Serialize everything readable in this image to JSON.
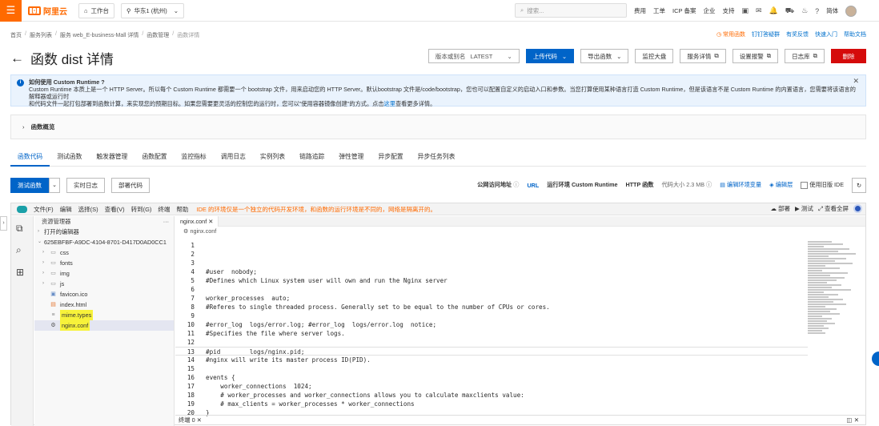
{
  "topbar": {
    "logo_text": "阿里云",
    "workbench": "工作台",
    "region": "华东1 (杭州)",
    "search_placeholder": "搜索...",
    "items": [
      "费用",
      "工单",
      "ICP 备案",
      "企业",
      "支持"
    ],
    "lang": "简体"
  },
  "breadcrumb": [
    "首页",
    "服务列表",
    "服务 web_E-business-Mall 详情",
    "函数管理",
    "函数详情"
  ],
  "top_links": {
    "hot": "常用函数",
    "items": [
      "钉钉答疑群",
      "有奖反馈",
      "快速入门",
      "帮助文档"
    ]
  },
  "title": "函数 dist 详情",
  "actions": {
    "version_label": "版本或别名",
    "version_value": "LATEST",
    "upload": "上传代码",
    "export": "导出函数",
    "monitor": "监控大盘",
    "service_detail": "服务详情",
    "alarm": "设置报警",
    "logs": "日志库",
    "delete": "删除"
  },
  "notice": {
    "title": "如何使用 Custom Runtime ?",
    "line1": "Custom Runtime 本质上是一个 HTTP Server。所以每个 Custom Runtime 都需要一个 bootstrap 文件，用来启动您的 HTTP Server。默认bootstrap 文件是/code/bootstrap，您也可以配置自定义的启动入口和参数。当您打算使用某种语言打造 Custom Runtime，但是该语言不是 Custom Runtime 的内置语言，您需要将该语言的解释器或运行时",
    "line2a": "和代码文件一起打包部署到函数计算，来实现您的预期目标。如果您需要更灵活的控制您的运行时，您可以\"使用容器镜像创建\"的方式。点击",
    "link": "这里",
    "line2b": "查看更多详情。"
  },
  "overview": "函数概览",
  "tabs": [
    "函数代码",
    "测试函数",
    "触发器管理",
    "函数配置",
    "监控指标",
    "调用日志",
    "实例列表",
    "链路追踪",
    "弹性管理",
    "异步配置",
    "异步任务列表"
  ],
  "subbar": {
    "test": "测试函数",
    "realtime_log": "实时日志",
    "deploy": "部署代码",
    "public_url": "公网访问地址",
    "url": "URL",
    "runtime": "运行环境 Custom Runtime",
    "http": "HTTP 函数",
    "size": "代码大小 2.3 MB",
    "edit_env": "编辑环境变量",
    "edit_layer": "编辑层",
    "old_ide": "使用旧版 IDE"
  },
  "ide": {
    "menu": [
      "文件(F)",
      "编辑",
      "选择(S)",
      "查看(V)",
      "转到(G)",
      "终端",
      "帮助"
    ],
    "warning": "IDE 的环境仅是一个独立的代码开发环境，和函数的运行环境是不同的，网络是隔离开的。",
    "right": [
      "部署",
      "测试",
      "查看全屏"
    ],
    "explorer_title": "资源管理器",
    "open_editors": "打开的编辑器",
    "root": "625EBFBF-A9DC-4104-8701-D417D0AD0CC1",
    "files": [
      {
        "name": "css",
        "type": "folder"
      },
      {
        "name": "fonts",
        "type": "folder"
      },
      {
        "name": "img",
        "type": "folder"
      },
      {
        "name": "js",
        "type": "folder"
      },
      {
        "name": "favicon.ico",
        "type": "file"
      },
      {
        "name": "index.html",
        "type": "file"
      },
      {
        "name": "mime.types",
        "type": "file"
      },
      {
        "name": "nginx.conf",
        "type": "file"
      }
    ],
    "tab": "nginx.conf",
    "crumb": "nginx.conf",
    "code": [
      {
        "n": "1",
        "t": ""
      },
      {
        "n": "2",
        "t": ""
      },
      {
        "n": "3",
        "t": ""
      },
      {
        "n": "4",
        "t": "#user  nobody;"
      },
      {
        "n": "5",
        "t": "#Defines which Linux system user will own and run the Nginx server"
      },
      {
        "n": "6",
        "t": ""
      },
      {
        "n": "7",
        "t": "worker_processes  auto;"
      },
      {
        "n": "8",
        "t": "#Referes to single threaded process. Generally set to be equal to the number of CPUs or cores."
      },
      {
        "n": "9",
        "t": ""
      },
      {
        "n": "10",
        "t": "#error_log  logs/error.log; #error_log  logs/error.log  notice;"
      },
      {
        "n": "11",
        "t": "#Specifies the file where server logs."
      },
      {
        "n": "12",
        "t": ""
      },
      {
        "n": "13",
        "t": "#pid        logs/nginx.pid;"
      },
      {
        "n": "14",
        "t": "#nginx will write its master process ID(PID)."
      },
      {
        "n": "15",
        "t": ""
      },
      {
        "n": "16",
        "t": "events {"
      },
      {
        "n": "17",
        "t": "    worker_connections  1024;"
      },
      {
        "n": "18",
        "t": "    # worker_processes and worker_connections allows you to calculate maxclients value:"
      },
      {
        "n": "19",
        "t": "    # max_clients = worker_processes * worker_connections"
      },
      {
        "n": "20",
        "t": "}"
      }
    ],
    "terminal": "终端 0"
  }
}
